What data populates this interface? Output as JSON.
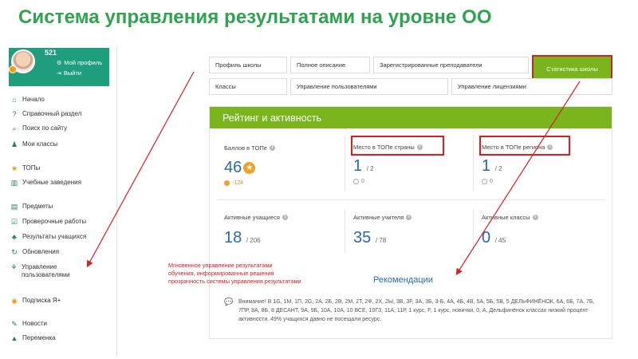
{
  "title": "Система управления результатами на уровне ОО",
  "sidebar": {
    "score": "521",
    "profile_link": "Мой профиль",
    "logout_link": "Выйти",
    "items": [
      {
        "label": "Начало",
        "icon": "home-icon"
      },
      {
        "label": "Справочный раздел",
        "icon": "help-circle-icon"
      },
      {
        "label": "Поиск по сайту",
        "icon": "search-icon"
      },
      {
        "label": "Мои классы",
        "icon": "class-people-icon"
      },
      {
        "label": "ТОПы",
        "icon": "star-icon"
      },
      {
        "label": "Учебные заведения",
        "icon": "school-building-icon"
      },
      {
        "label": "Предметы",
        "icon": "book-icon"
      },
      {
        "label": "Проверочные работы",
        "icon": "checklist-icon"
      },
      {
        "label": "Результаты учащихся",
        "icon": "results-users-icon"
      },
      {
        "label": "Обновления",
        "icon": "refresh-icon"
      },
      {
        "label": "Управление пользователями",
        "icon": "user-management-icon"
      },
      {
        "label": "Подписка Я+",
        "icon": "subscription-icon"
      },
      {
        "label": "Новости",
        "icon": "news-icon"
      },
      {
        "label": "Переменка",
        "icon": "bell-icon"
      }
    ]
  },
  "tabs": {
    "row1": [
      "Профиль школы",
      "Полное описание",
      "Зарегистрированные преподаватели",
      "Статистика школы"
    ],
    "row2": [
      "Классы",
      "Управление пользователями",
      "Управление лицензиями"
    ],
    "active": "Статистика школы"
  },
  "panel": {
    "heading": "Рейтинг и активность",
    "stats_top": [
      {
        "label": "Баллов в ТОПе",
        "value": "46",
        "sub": "-124"
      },
      {
        "label": "Место в ТОПе страны",
        "value": "1",
        "of": "/ 2",
        "sub": "0"
      },
      {
        "label": "Место в ТОПе региона",
        "value": "1",
        "of": "/ 2",
        "sub": "0"
      }
    ],
    "stats_bottom": [
      {
        "label": "Активные учащиеся",
        "value": "18",
        "of": "/ 206"
      },
      {
        "label": "Активные учителя",
        "value": "35",
        "of": "/ 78"
      },
      {
        "label": "Активные классы",
        "value": "0",
        "of": "/ 45"
      }
    ],
    "recommendations_title": "Рекомендации",
    "recommendation_text": "Внимание! В 1G, 1M, 1П, 2G, 2A, 2Б, 2В, 2М, 2Т, 2Ф, 2Х, 2Ы, 3В, 3F, 3А, 3Б, 3-Б, 4А, 4Б, 4В, 5А, 5Б, 5В, 5 ДЕЛЬФИНЁНОК, 6А, 6Б, 7А, 7Б, 7ПР, 8А, 8Б, 8 ДЕСАНТ, 9А, 9Б, 10А, 10А, 10 ВСЕ, 10ГЗ, 11А, 11Р, 1 курс, F, 1 курс, новички, 0, А, Дельфинёнок классах низкий процент активности. 49% учащихся давно не посещали ресурс."
  },
  "annotation": {
    "line1": "Мгновенное управление результатами",
    "line2": "обучения, информированные решения",
    "line3": "прозрачность системы управления результатами"
  },
  "colors": {
    "title_green": "#2fa34f",
    "panel_green": "#7ab51d",
    "highlight_red": "#d62020",
    "value_blue": "#2b6aa8"
  }
}
